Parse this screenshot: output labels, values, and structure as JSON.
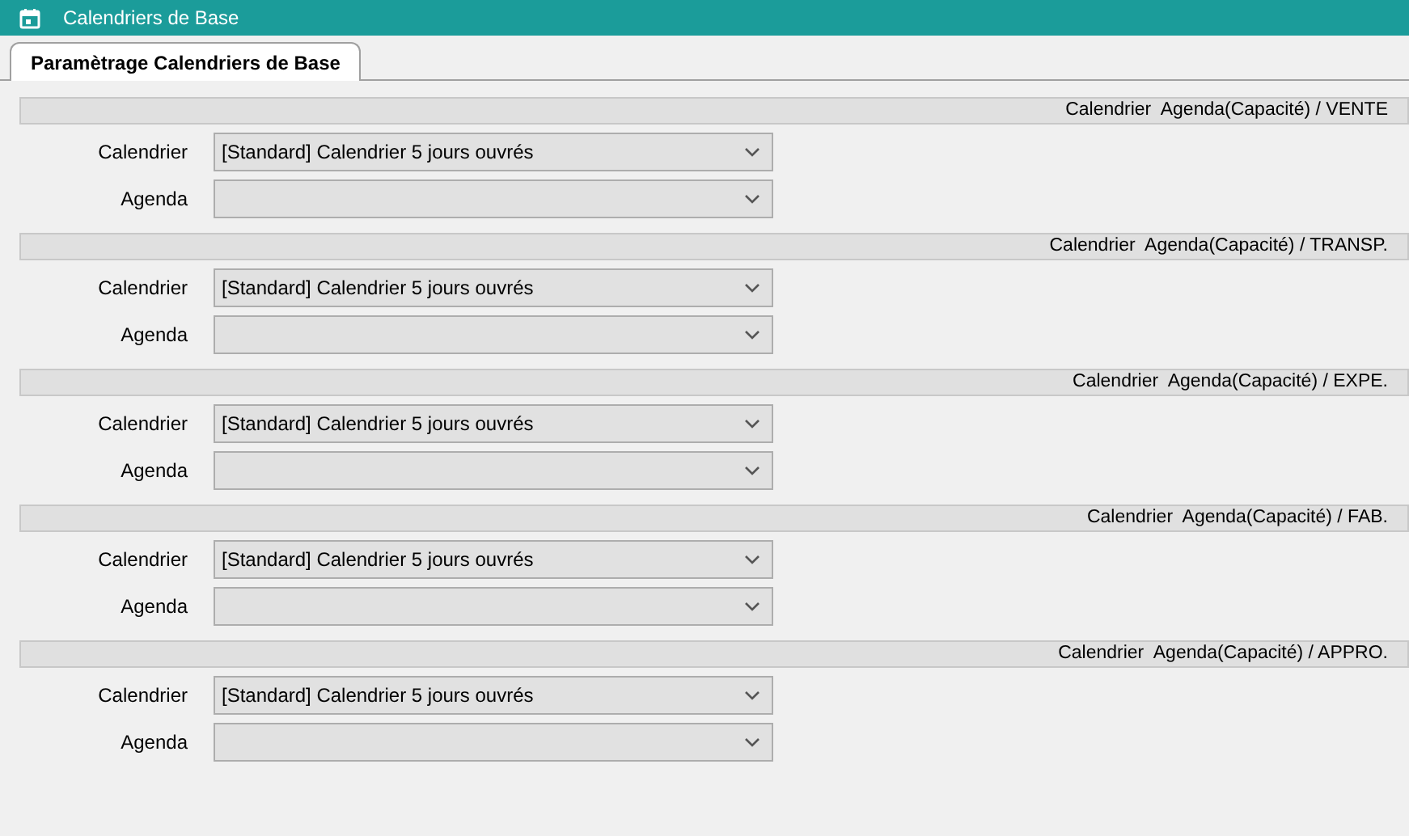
{
  "window": {
    "title": "Calendriers de Base"
  },
  "tabs": [
    {
      "label": "Paramètrage Calendriers de Base",
      "selected": true
    }
  ],
  "sections": [
    {
      "title": "Calendrier  Agenda(Capacité) / VENTE",
      "fields": [
        {
          "label": "Calendrier",
          "value": "[Standard] Calendrier 5 jours ouvrés"
        },
        {
          "label": "Agenda"
        }
      ]
    },
    {
      "title": "Calendrier  Agenda(Capacité) / TRANSP.",
      "fields": [
        {
          "label": "Calendrier",
          "value": "[Standard] Calendrier 5 jours ouvrés"
        },
        {
          "label": "Agenda"
        }
      ]
    },
    {
      "title": "Calendrier  Agenda(Capacité) / EXPE.",
      "fields": [
        {
          "label": "Calendrier",
          "value": "[Standard] Calendrier 5 jours ouvrés"
        },
        {
          "label": "Agenda"
        }
      ]
    },
    {
      "title": "Calendrier  Agenda(Capacité) / FAB.",
      "fields": [
        {
          "label": "Calendrier",
          "value": "[Standard] Calendrier 5 jours ouvrés"
        },
        {
          "label": "Agenda"
        }
      ]
    },
    {
      "title": "Calendrier  Agenda(Capacité) / APPRO.",
      "fields": [
        {
          "label": "Calendrier",
          "value": "[Standard] Calendrier 5 jours ouvrés"
        },
        {
          "label": "Agenda"
        }
      ]
    }
  ]
}
